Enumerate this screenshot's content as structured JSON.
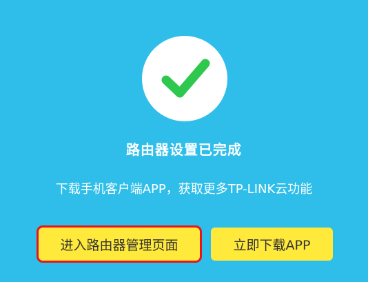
{
  "success": {
    "icon": "checkmark-icon",
    "circle_color": "#FFFFFF",
    "check_color": "#2DC84D"
  },
  "title": "路由器设置已完成",
  "description": "下载手机客户端APP，获取更多TP-LINK云功能",
  "buttons": {
    "manage_label": "进入路由器管理页面",
    "download_label": "立即下载APP",
    "button_color": "#FFE93A",
    "highlight_color": "#E8151B"
  },
  "theme": {
    "background": "#2EBEE9",
    "text": "#FFFFFF"
  }
}
